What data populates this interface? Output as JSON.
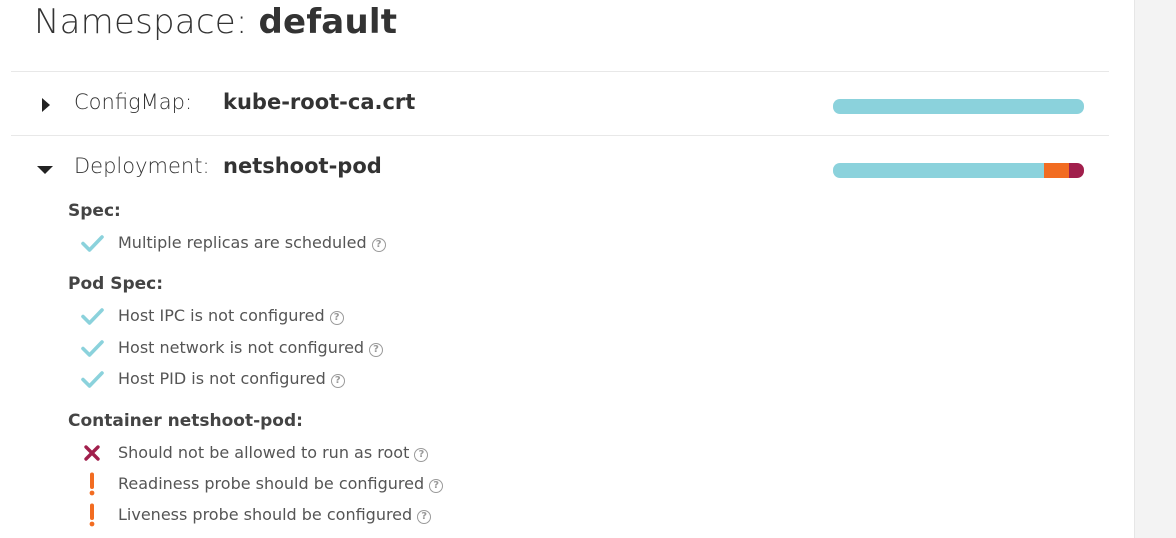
{
  "header": {
    "prefix": "Namespace: ",
    "namespace": "default"
  },
  "resources": [
    {
      "kind": "ConfigMap:",
      "name": "kube-root-ca.crt",
      "expanded": false,
      "score_bar": {
        "passing": 1.0,
        "warning": 0.0,
        "danger": 0.0
      }
    },
    {
      "kind": "Deployment:",
      "name": "netshoot-pod",
      "expanded": true,
      "score_bar": {
        "passing": 0.84,
        "warning": 0.1,
        "danger": 0.06
      },
      "sections": [
        {
          "title": "Spec:",
          "checks": [
            {
              "status": "success",
              "icon": "check-icon",
              "message": "Multiple replicas are scheduled",
              "help": "?"
            }
          ]
        },
        {
          "title": "Pod Spec:",
          "checks": [
            {
              "status": "success",
              "icon": "check-icon",
              "message": "Host IPC is not configured",
              "help": "?"
            },
            {
              "status": "success",
              "icon": "check-icon",
              "message": "Host network is not configured",
              "help": "?"
            },
            {
              "status": "success",
              "icon": "check-icon",
              "message": "Host PID is not configured",
              "help": "?"
            }
          ]
        },
        {
          "title": "Container netshoot-pod:",
          "checks": [
            {
              "status": "danger",
              "icon": "x-icon",
              "message": "Should not be allowed to run as root",
              "help": "?"
            },
            {
              "status": "warning",
              "icon": "exclamation-icon",
              "message": "Readiness probe should be configured",
              "help": "?"
            },
            {
              "status": "warning",
              "icon": "exclamation-icon",
              "message": "Liveness probe should be configured",
              "help": "?"
            }
          ]
        }
      ]
    }
  ],
  "colors": {
    "success": "#8bd2dc",
    "warning": "#f26c21",
    "danger": "#a11f4c",
    "text": "#333333",
    "muted": "#555555"
  }
}
